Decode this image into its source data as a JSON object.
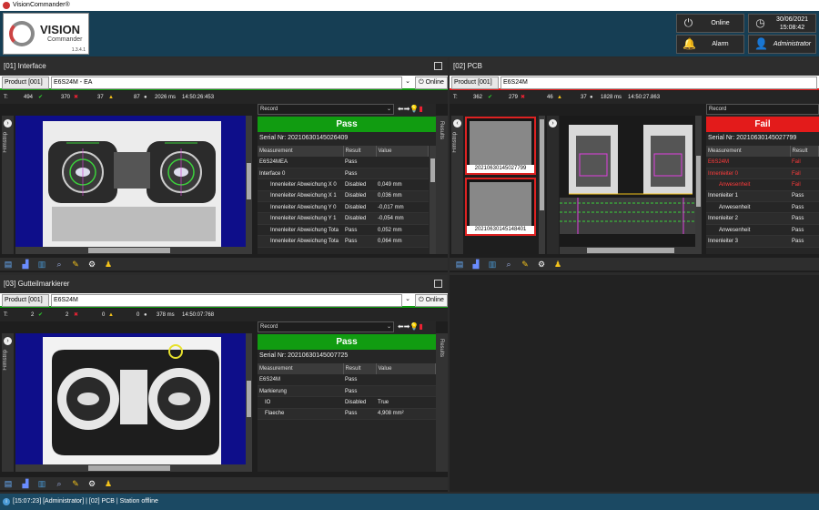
{
  "app": {
    "title": "VisionCommander®",
    "logo_text": "VISION",
    "logo_sub": "Commander",
    "version": "1.3.4.1"
  },
  "header": {
    "online_label": "Online",
    "alarm_label": "Alarm",
    "date": "30/06/2021",
    "time": "15:08:42",
    "user": "Administrator"
  },
  "colors": {
    "pass": "#119c11",
    "fail": "#e31b1b",
    "header": "#163e54",
    "status": "#1b4963"
  },
  "panels": {
    "p1": {
      "title": "[01] Interface",
      "product_label": "Product [001]",
      "product_value": "E6S24M - EA",
      "online_button": "Online",
      "stats": {
        "t": "T:",
        "total": "494",
        "pass": "370",
        "fail": "37",
        "warn": "87",
        "time": "2026 ms",
        "clock": "14:50:26:453"
      },
      "filmstrip_label": "Filmstrip",
      "results_label": "Results",
      "record_label": "Record",
      "status": "Pass",
      "serial": "Serial Nr: 20210630145026409",
      "columns": [
        "Measurement",
        "Result",
        "Value"
      ],
      "rows": [
        [
          "E6S24MEA",
          "Pass",
          ""
        ],
        [
          "Interface 0",
          "Pass",
          ""
        ],
        [
          "Innenleiter Abweichung X 0",
          "Disabled",
          "0,049 mm"
        ],
        [
          "Innenleiter Abweichung X 1",
          "Disabled",
          "0,036 mm"
        ],
        [
          "Innenleiter Abweichung Y 0",
          "Disabled",
          "-0,017 mm"
        ],
        [
          "Innenleiter Abweichung Y 1",
          "Disabled",
          "-0,054 mm"
        ],
        [
          "Innenleiter Abweichung Tota",
          "Pass",
          "0,052 mm"
        ],
        [
          "Innenleiter Abweichung Tota",
          "Pass",
          "0,064 mm"
        ]
      ]
    },
    "p2": {
      "title": "[02] PCB",
      "product_label": "Product [001]",
      "product_value": "E6S24M",
      "stats": {
        "t": "T:",
        "total": "362",
        "pass": "279",
        "fail": "46",
        "warn": "37",
        "time": "1828 ms",
        "clock": "14:50:27.863"
      },
      "filmstrip_label": "Filmstrip",
      "thumbs": [
        "20210630145027799",
        "20210630145148401"
      ],
      "record_label": "Record",
      "status": "Fail",
      "serial": "Serial Nr: 20210630145027799",
      "columns": [
        "Measurement",
        "Result"
      ],
      "rows": [
        [
          "E6S24M",
          "Fail"
        ],
        [
          "Innenleiter 0",
          "Fail"
        ],
        [
          "Anwesenheit",
          "Fail"
        ],
        [
          "Innenleiter 1",
          "Pass"
        ],
        [
          "Anwesenheit",
          "Pass"
        ],
        [
          "Innenleiter 2",
          "Pass"
        ],
        [
          "Anwesenheit",
          "Pass"
        ],
        [
          "Innenleiter 3",
          "Pass"
        ]
      ]
    },
    "p3": {
      "title": "[03] Gutteilmarkierer",
      "product_label": "Product [001]",
      "product_value": "E6S24M",
      "online_button": "Online",
      "stats": {
        "t": "T:",
        "total": "2",
        "pass": "2",
        "fail": "0",
        "warn": "0",
        "time": "378 ms",
        "clock": "14:50:07:768"
      },
      "filmstrip_label": "Filmstrip",
      "results_label": "Results",
      "record_label": "Record",
      "status": "Pass",
      "serial": "Serial Nr: 20210630145007725",
      "columns": [
        "Measurement",
        "Result",
        "Value"
      ],
      "rows": [
        [
          "E6S24M",
          "Pass",
          ""
        ],
        [
          "Markierung",
          "Pass",
          ""
        ],
        [
          "IO",
          "Disabled",
          "True"
        ],
        [
          "Flaeche",
          "Pass",
          "4,908 mm²"
        ]
      ]
    }
  },
  "statusbar": {
    "text": "[15:07:23] [Administrator] | [02] PCB | Station offline"
  }
}
